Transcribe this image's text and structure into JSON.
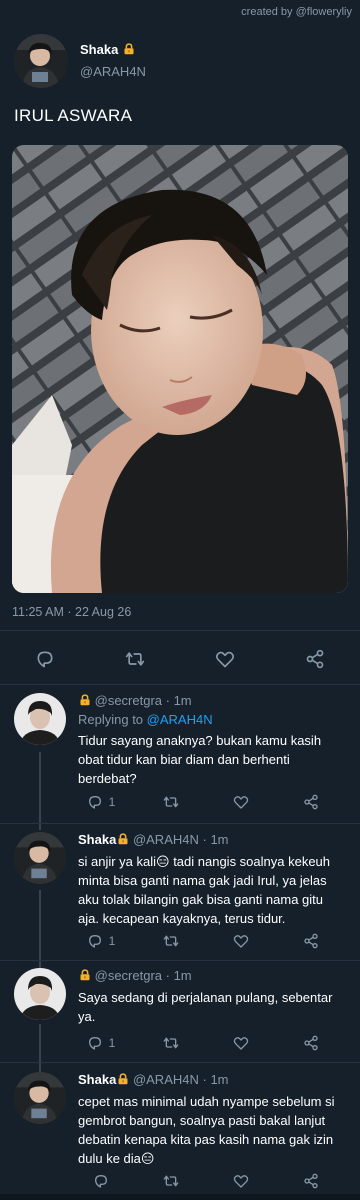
{
  "credit": "created by @floweryliy",
  "main_tweet": {
    "name": "Shaka",
    "handle": "@ARAH4N",
    "text": "IRUL ASWARA",
    "timestamp": "11:25 AM · 22 Aug 26"
  },
  "replies": [
    {
      "handle": "@secretgra",
      "time": "· 1m",
      "replying_prefix": "Replying to ",
      "replying_to": "@ARAH4N",
      "text": "Tidur sayang anaknya? bukan kamu kasih obat tidur kan biar diam dan berhenti berdebat?",
      "reply_count": "1"
    },
    {
      "name": "Shaka",
      "handle": "@ARAH4N",
      "time": "· 1m",
      "text": "si anjir ya kali😑 tadi nangis soalnya kekeuh minta bisa ganti nama gak jadi Irul, ya jelas aku tolak bilangin gak bisa ganti nama gitu aja. kecapean kayaknya, terus tidur.",
      "reply_count": "1"
    },
    {
      "handle": "@secretgra",
      "time": "· 1m",
      "text": "Saya sedang di perjalanan pulang, sebentar ya.",
      "reply_count": "1"
    },
    {
      "name": "Shaka",
      "handle": "@ARAH4N",
      "time": "· 1m",
      "text": "cepet mas minimal udah nyampe sebelum si gembrot bangun, soalnya pasti bakal lanjut debatin kenapa kita pas kasih nama gak izin dulu ke dia😑"
    }
  ],
  "colors": {
    "background": "#15202b",
    "muted": "#8899a6",
    "link": "#1da1f2",
    "divider": "#263340"
  },
  "icons": [
    "reply-icon",
    "retweet-icon",
    "like-icon",
    "share-icon",
    "lock-icon"
  ]
}
